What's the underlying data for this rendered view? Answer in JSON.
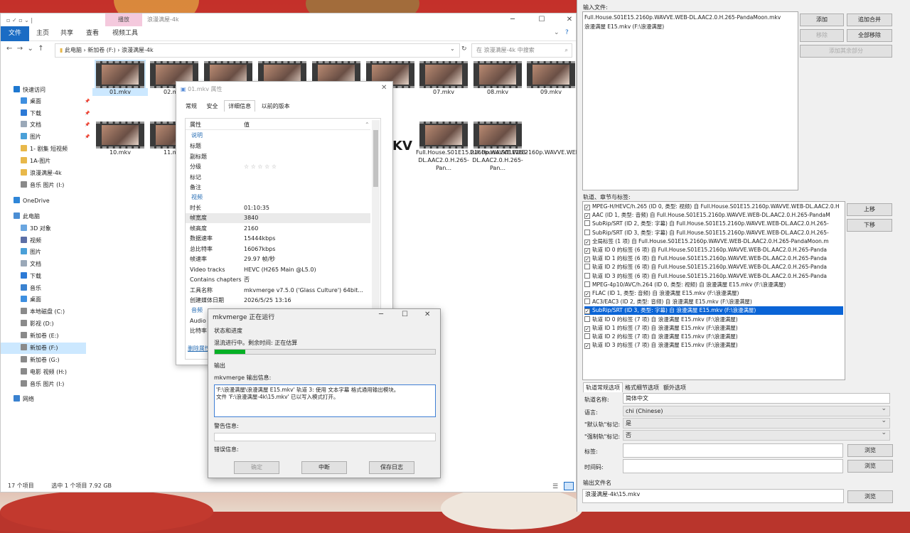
{
  "explorer": {
    "context_tab": "播放",
    "window_title": "浪漫满屋-4k",
    "menu": [
      "文件",
      "主页",
      "共享",
      "查看",
      "视频工具"
    ],
    "breadcrumb": "此电脑 › 新加卷 (F:) › 浪漫满屋-4k",
    "search_placeholder": "在 浪漫满屋-4k 中搜索",
    "nav": [
      {
        "label": "快速访问",
        "icon": "star-icon"
      },
      {
        "label": "桌面",
        "icon": "desktop-icon"
      },
      {
        "label": "下载",
        "icon": "download-icon"
      },
      {
        "label": "文档",
        "icon": "document-icon"
      },
      {
        "label": "图片",
        "icon": "picture-icon"
      },
      {
        "label": "1-  剧集 短视频",
        "icon": "folder-icon"
      },
      {
        "label": "1A-图片",
        "icon": "folder-icon"
      },
      {
        "label": "浪漫满屋-4k",
        "icon": "folder-icon"
      },
      {
        "label": "音乐  图片 (I:)",
        "icon": "drive-icon"
      },
      {
        "label": "OneDrive",
        "icon": "cloud-icon"
      },
      {
        "label": "此电脑",
        "icon": "computer-icon"
      },
      {
        "label": "3D 对象",
        "icon": "cube-icon"
      },
      {
        "label": "视频",
        "icon": "video-icon"
      },
      {
        "label": "图片",
        "icon": "picture-icon"
      },
      {
        "label": "文档",
        "icon": "document-icon"
      },
      {
        "label": "下载",
        "icon": "download-icon"
      },
      {
        "label": "音乐",
        "icon": "music-icon"
      },
      {
        "label": "桌面",
        "icon": "desktop-icon"
      },
      {
        "label": "本地磁盘 (C:)",
        "icon": "drive-icon"
      },
      {
        "label": "影视 (D:)",
        "icon": "drive-icon"
      },
      {
        "label": "新加卷 (E:)",
        "icon": "drive-icon"
      },
      {
        "label": "新加卷 (F:)",
        "icon": "drive-icon"
      },
      {
        "label": "新加卷 (G:)",
        "icon": "drive-icon"
      },
      {
        "label": "电影  视频 (H:)",
        "icon": "drive-icon"
      },
      {
        "label": "音乐  图片 (I:)",
        "icon": "drive-icon"
      },
      {
        "label": "网络",
        "icon": "network-icon"
      }
    ],
    "files": [
      "01.mkv",
      "02.mkv",
      "",
      "",
      "",
      "",
      "07.mkv",
      "08.mkv",
      "09.mkv",
      "10.mkv",
      "11.mkv",
      "Full.House.S01E15.2160p.WAVVE.WEB-DL.AAC2.0.H.265-Pan...",
      "Full.House.S01E16.2160p.WAVVE.WEB-DL.AAC2.0.H.265-Pan..."
    ],
    "logo_text": "KV",
    "status_count": "17 个项目",
    "status_selected": "选中 1 个项目  7.92 GB"
  },
  "props": {
    "title": "01.mkv 属性",
    "tabs": [
      "常规",
      "安全",
      "详细信息",
      "以前的版本"
    ],
    "header_key": "属性",
    "header_val": "值",
    "section_desc": "说明",
    "section_video": "视频",
    "section_audio": "音频",
    "rows_desc": [
      {
        "k": "标题",
        "v": ""
      },
      {
        "k": "副标题",
        "v": ""
      },
      {
        "k": "分级",
        "v": "☆ ☆ ☆ ☆ ☆"
      },
      {
        "k": "标记",
        "v": ""
      },
      {
        "k": "备注",
        "v": ""
      }
    ],
    "rows_video": [
      {
        "k": "时长",
        "v": "01:10:35"
      },
      {
        "k": "帧宽度",
        "v": "3840"
      },
      {
        "k": "帧高度",
        "v": "2160"
      },
      {
        "k": "数据速率",
        "v": "15444kbps"
      },
      {
        "k": "总比特率",
        "v": "16067kbps"
      },
      {
        "k": "帧速率",
        "v": "29.97 帧/秒"
      },
      {
        "k": "Video tracks",
        "v": "HEVC (H265 Main @L5.0)"
      },
      {
        "k": "Contains chapters",
        "v": "否"
      },
      {
        "k": "工具名称",
        "v": "mkvmerge v7.5.0 ('Glass Culture') 64bit..."
      },
      {
        "k": "创建媒体日期",
        "v": "2026/5/25 13:16"
      }
    ],
    "rows_audio": [
      {
        "k": "Audio",
        "v": ""
      },
      {
        "k": "比特率",
        "v": ""
      }
    ],
    "remove_link": "删除属性"
  },
  "progress": {
    "title": "mkvmerge 正在运行",
    "section_status": "状态和进度",
    "status_text": "混流进行中。剩余时间: 正在估算",
    "percent": 0.14,
    "section_output": "输出",
    "output_label": "mkvmerge 输出信息:",
    "output_text": "'F:\\浪漫满屋\\浪漫满屋 E15.mkv' 轨道 3: 使用 文本字幕 格式通用输出模块。\n文件 'F:\\浪漫满屋-4k\\15.mkv' 已以写入模式打开。",
    "warnings_label": "警告信息:",
    "errors_label": "错误信息:",
    "btn_ok": "确定",
    "btn_abort": "中断",
    "btn_save_log": "保存日志"
  },
  "mkv": {
    "input_label": "输入文件:",
    "input_files": [
      "Full.House.S01E15.2160p.WAVVE.WEB-DL.AAC2.0.H.265-PandaMoon.mkv",
      "浪漫满屋 E15.mkv (F:\\浪漫满屋)"
    ],
    "btn_add": "添加",
    "btn_append": "追加合并",
    "btn_remove": "移除",
    "btn_remove_all": "全部移除",
    "btn_additional": "添加其余部分",
    "tracks_label": "轨道、章节与标签:",
    "tracks": [
      {
        "checked": true,
        "text": "MPEG-H/HEVC/h.265 (ID 0, 类型: 视频) 自 Full.House.S01E15.2160p.WAVVE.WEB-DL.AAC2.0.H"
      },
      {
        "checked": true,
        "text": "AAC (ID 1, 类型: 音频) 自 Full.House.S01E15.2160p.WAVVE.WEB-DL.AAC2.0.H.265-PandaM"
      },
      {
        "checked": false,
        "text": "SubRip/SRT (ID 2, 类型: 字幕) 自 Full.House.S01E15.2160p.WAVVE.WEB-DL.AAC2.0.H.265-"
      },
      {
        "checked": false,
        "text": "SubRip/SRT (ID 3, 类型: 字幕) 自 Full.House.S01E15.2160p.WAVVE.WEB-DL.AAC2.0.H.265-"
      },
      {
        "checked": true,
        "text": "全局标签 (1 项) 自 Full.House.S01E15.2160p.WAVVE.WEB-DL.AAC2.0.H.265-PandaMoon.m"
      },
      {
        "checked": true,
        "text": "轨道 ID 0 的标签 (6 项) 自 Full.House.S01E15.2160p.WAVVE.WEB-DL.AAC2.0.H.265-Panda"
      },
      {
        "checked": true,
        "text": "轨道 ID 1 的标签 (6 项) 自 Full.House.S01E15.2160p.WAVVE.WEB-DL.AAC2.0.H.265-Panda"
      },
      {
        "checked": false,
        "text": "轨道 ID 2 的标签 (6 项) 自 Full.House.S01E15.2160p.WAVVE.WEB-DL.AAC2.0.H.265-Panda"
      },
      {
        "checked": false,
        "text": "轨道 ID 3 的标签 (6 项) 自 Full.House.S01E15.2160p.WAVVE.WEB-DL.AAC2.0.H.265-Panda"
      },
      {
        "checked": false,
        "text": "MPEG-4p10/AVC/h.264 (ID 0, 类型: 视频) 自 浪漫满屋 E15.mkv (F:\\浪漫满屋)"
      },
      {
        "checked": true,
        "text": "FLAC (ID 1, 类型: 音频) 自 浪漫满屋 E15.mkv (F:\\浪漫满屋)"
      },
      {
        "checked": false,
        "text": "AC3/EAC3 (ID 2, 类型: 音频) 自 浪漫满屋 E15.mkv (F:\\浪漫满屋)"
      },
      {
        "checked": true,
        "text": "SubRip/SRT (ID 3, 类型: 字幕) 自 浪漫满屋 E15.mkv (F:\\浪漫满屋)"
      },
      {
        "checked": false,
        "text": "轨道 ID 0 的标签 (7 项) 自 浪漫满屋 E15.mkv (F:\\浪漫满屋)"
      },
      {
        "checked": true,
        "text": "轨道 ID 1 的标签 (7 项) 自 浪漫满屋 E15.mkv (F:\\浪漫满屋)"
      },
      {
        "checked": false,
        "text": "轨道 ID 2 的标签 (7 项) 自 浪漫满屋 E15.mkv (F:\\浪漫满屋)"
      },
      {
        "checked": true,
        "text": "轨道 ID 3 的标签 (7 项) 自 浪漫满屋 E15.mkv (F:\\浪漫满屋)"
      }
    ],
    "selected_track": 12,
    "btn_up": "上移",
    "btn_down": "下移",
    "tabs": [
      "轨道常规选项",
      "格式细节选项",
      "额外选项"
    ],
    "name_label": "轨道名称:",
    "name_value": "简体中文",
    "lang_label": "语言:",
    "lang_value": "chi (Chinese)",
    "default_label": "\"默认轨\"标记:",
    "default_value": "是",
    "forced_label": "\"强制轨\"标记:",
    "forced_value": "否",
    "tags_label": "标签:",
    "timecodes_label": "时间码:",
    "btn_browse": "浏览",
    "output_label": "输出文件名",
    "output_value": "浪漫满屋-4k\\15.mkv",
    "colors": {
      "selected": "#0a64d6",
      "progress": "#06b025",
      "accent": "#1b6cc4"
    }
  }
}
